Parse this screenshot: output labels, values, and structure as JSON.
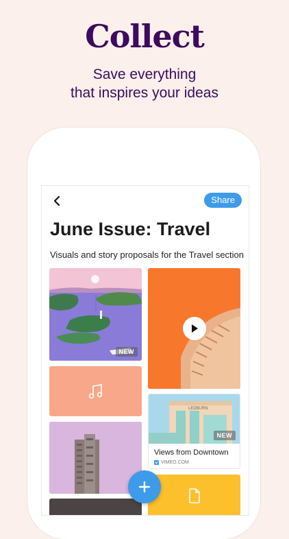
{
  "hero": {
    "title": "Collect",
    "subtitle_line1": "Save everything",
    "subtitle_line2": "that inspires your ideas"
  },
  "colors": {
    "background": "#fbf0eb",
    "brand": "#3d0a5e",
    "accent": "#3d9be9"
  },
  "board": {
    "share_label": "Share",
    "title": "June Issue: Travel",
    "description": "Visuals and story proposals for the Travel section"
  },
  "cards": {
    "landscape_badge": "NEW",
    "audio_icon": "music-note-icon",
    "video_icon": "play-icon",
    "link": {
      "badge": "NEW",
      "title": "Views from Downtown",
      "source": "VIMEO.COM"
    },
    "file_icon": "document-icon"
  },
  "icons": {
    "back": "chevron-left-icon",
    "add": "plus-icon"
  }
}
